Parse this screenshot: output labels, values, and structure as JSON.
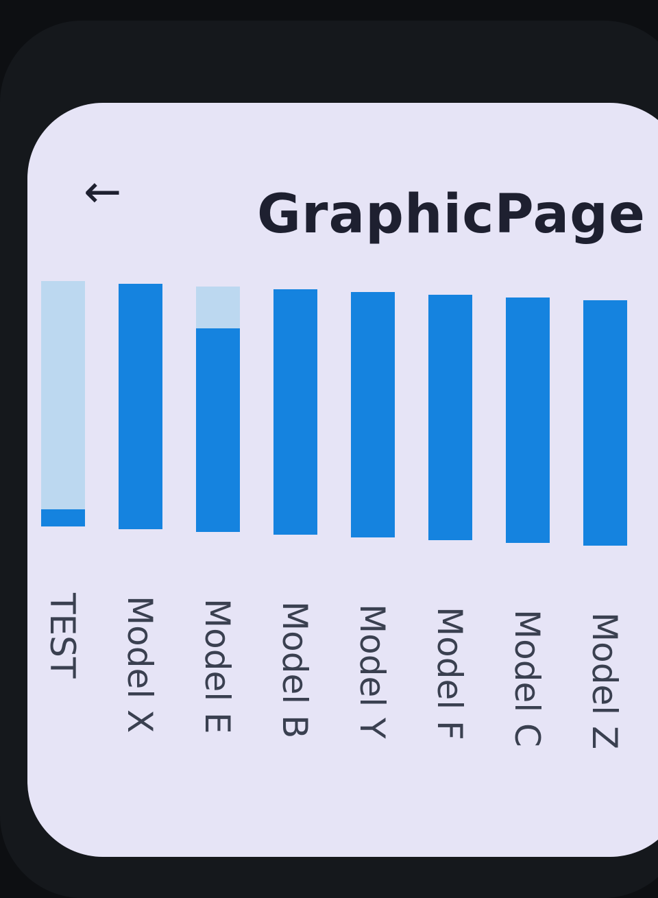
{
  "header": {
    "title": "GraphicPage",
    "back_icon": "arrow-left-icon"
  },
  "colors": {
    "bar": "#1583df",
    "track": "#bcd8f0",
    "background": "#e6e4f6"
  },
  "chart_data": {
    "type": "bar",
    "categories": [
      "TEST",
      "Model X",
      "Model E",
      "Model B",
      "Model Y",
      "Model F",
      "Model C",
      "Model Z"
    ],
    "values": [
      7,
      100,
      83,
      100,
      100,
      100,
      100,
      100
    ],
    "ylim": [
      0,
      100
    ],
    "grid": false,
    "title": "",
    "xlabel": "",
    "ylabel": ""
  }
}
